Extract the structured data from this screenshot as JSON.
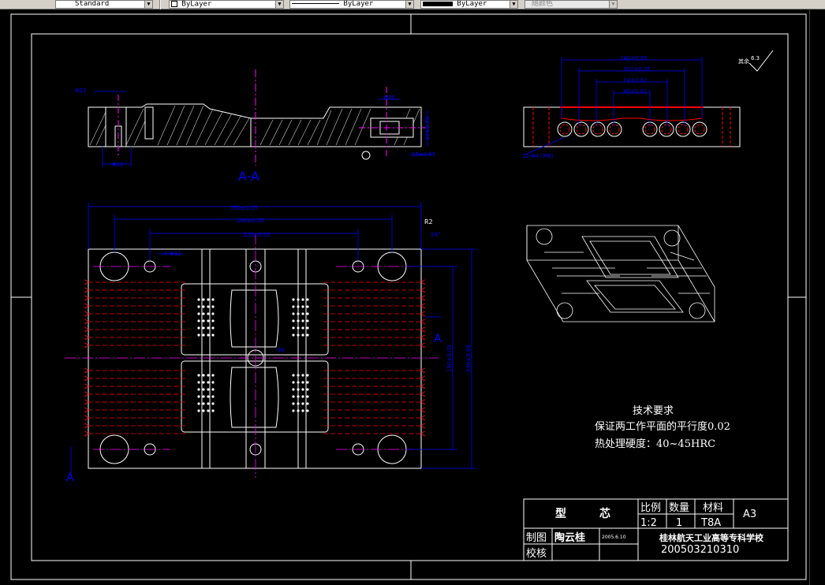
{
  "toolbar": {
    "text_style": "Standard",
    "layer_color": "ByLayer",
    "linetype": "ByLayer",
    "lineweight": "ByLayer",
    "plotstyle": "随颜色"
  },
  "drawing": {
    "section_label": "A-A",
    "section_mark_a": "A",
    "surface_finish_top": "其余",
    "surface_finish_value": "6.3",
    "dims": {
      "top_width_outer": "140±0.05",
      "top_width_2": "102±0.05",
      "top_width_3": "74±0.02",
      "top_width_4": "40±0.02",
      "bottom_outer": "350±0.05",
      "bottom_mid": "290±0.05",
      "bottom_inner": "220±0.02",
      "height_outer": "230±0.05",
      "height_inner": "190±0.05",
      "hole_dia": "4-Φ32",
      "sec_left_1": "Φ25",
      "sec_left_2": "Φ20",
      "sec_right_1": "Φ36",
      "sec_right_h": "10±0.05",
      "sec_right_w": "15±0.05",
      "side_hole": "Φ8",
      "side_angle": "20°",
      "corner_note": "R2",
      "side_note": "12-Φ4 (M8)"
    },
    "tech_req": {
      "title": "技术要求",
      "line1": "保证两工作平面的平行度0.02",
      "line2": "热处理硬度：40~45HRC"
    }
  },
  "title_block": {
    "part_name_1": "型",
    "part_name_2": "芯",
    "scale_label": "比例",
    "qty_label": "数量",
    "material_label": "材料",
    "scale": "1:2",
    "qty": "1",
    "material": "T8A",
    "sheet": "A3",
    "drawn_label": "制图",
    "drawn_by": "陶云桂",
    "date": "2005.6.10",
    "check_label": "校核",
    "school": "桂林航天工业高等专科学校",
    "student_no": "200503210310"
  },
  "colors": {
    "frame": "#ffffff",
    "dim": "#0000ff",
    "center": "#ff00ff",
    "hidden": "#ff0000"
  }
}
